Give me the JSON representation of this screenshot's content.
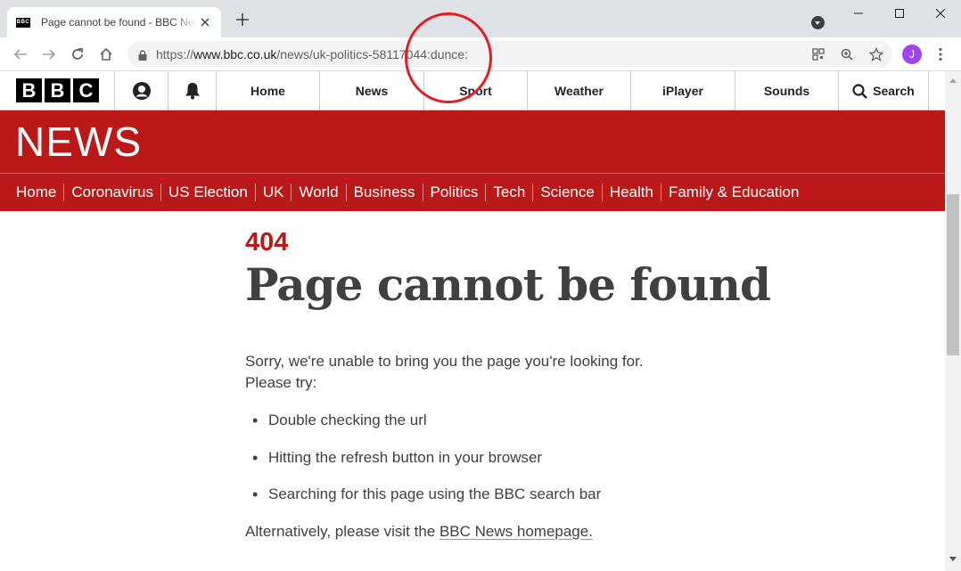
{
  "browser": {
    "tab_title": "Page cannot be found - BBC News",
    "tab_favicon_text": "BBC",
    "url_prefix": "https://",
    "url_host": "www.bbc.co.uk",
    "url_path": "/news/uk-politics-58117044:dunce:",
    "avatar_letter": "J"
  },
  "bbc_nav": {
    "logo_letters": [
      "B",
      "B",
      "C"
    ],
    "items": [
      {
        "label": "Home"
      },
      {
        "label": "News"
      },
      {
        "label": "Sport"
      },
      {
        "label": "Weather"
      },
      {
        "label": "iPlayer"
      },
      {
        "label": "Sounds"
      }
    ],
    "search_label": "Search"
  },
  "news": {
    "brand": "NEWS",
    "nav": [
      "Home",
      "Coronavirus",
      "US Election",
      "UK",
      "World",
      "Business",
      "Politics",
      "Tech",
      "Science",
      "Health",
      "Family & Education"
    ]
  },
  "error": {
    "code": "404",
    "title": "Page cannot be found",
    "intro_line1": "Sorry, we're unable to bring you the page you're looking for.",
    "intro_line2": "Please try:",
    "suggestions": [
      "Double checking the url",
      "Hitting the refresh button in your browser",
      "Searching for this page using the BBC search bar"
    ],
    "alt_prefix": "Alternatively, please visit the ",
    "alt_link": "BBC News homepage."
  },
  "colors": {
    "bbc_red": "#bb1919",
    "annotation": "#e41e26",
    "avatar": "#a142f4"
  }
}
